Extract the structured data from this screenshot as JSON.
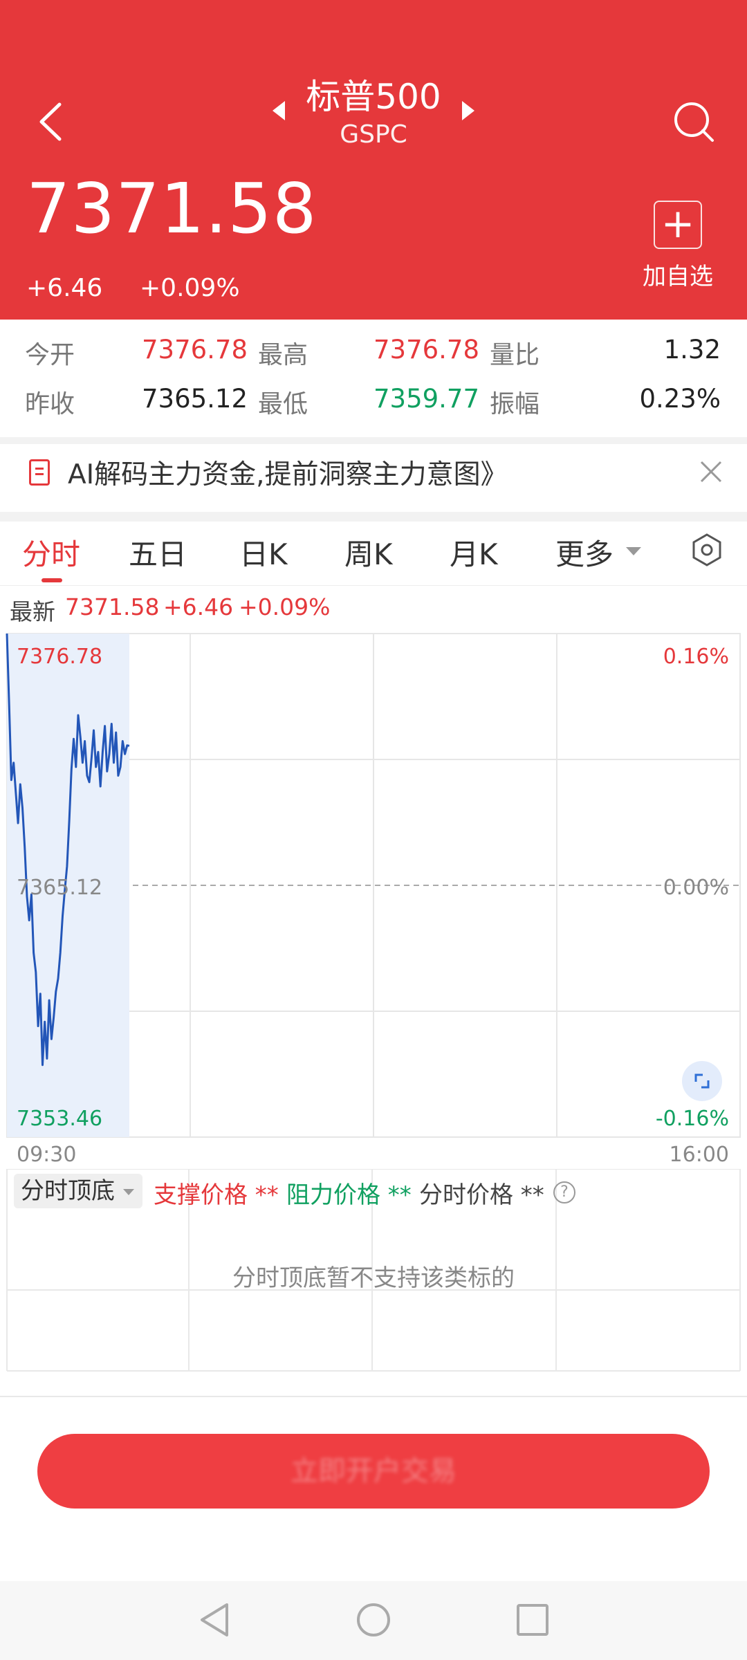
{
  "header": {
    "title": "标普500",
    "subtitle": "GSPC",
    "price": "7371.58",
    "change": "+6.46",
    "change_pct": "+0.09%",
    "add_label": "加自选"
  },
  "stats": {
    "open_label": "今开",
    "open": "7376.78",
    "high_label": "最高",
    "high": "7376.78",
    "vol_ratio_label": "量比",
    "vol_ratio": "1.32",
    "prev_close_label": "昨收",
    "prev_close": "7365.12",
    "low_label": "最低",
    "low": "7359.77",
    "amplitude_label": "振幅",
    "amplitude": "0.23%"
  },
  "banner": {
    "text": "AI解码主力资金,提前洞察主力意图》"
  },
  "tabs": [
    "分时",
    "五日",
    "日K",
    "周K",
    "月K",
    "更多"
  ],
  "latest": {
    "label": "最新",
    "price": "7371.58",
    "change": "+6.46",
    "change_pct": "+0.09%"
  },
  "chart_data": {
    "type": "line",
    "title": "",
    "xlabel": "",
    "ylabel": "",
    "x_range": [
      "09:30",
      "16:00"
    ],
    "ylim": [
      7353.46,
      7376.78
    ],
    "y_ticks": [
      "7376.78",
      "7365.12",
      "7353.46"
    ],
    "y_right_ticks": [
      "0.16%",
      "0.00%",
      "-0.16%"
    ],
    "reference_line": 7365.12,
    "grid": true,
    "series": [
      {
        "color": "#2356b8",
        "values": [
          7376.78,
          7373.5,
          7370.0,
          7370.8,
          7369.4,
          7368.0,
          7369.8,
          7368.7,
          7366.9,
          7364.6,
          7363.5,
          7364.7,
          7362.0,
          7361.1,
          7358.6,
          7360.1,
          7356.8,
          7358.8,
          7357.1,
          7359.8,
          7358.0,
          7359.0,
          7360.2,
          7360.8,
          7362.0,
          7363.7,
          7364.9,
          7366.0,
          7368.1,
          7370.5,
          7371.9,
          7370.6,
          7373.0,
          7372.0,
          7370.8,
          7371.8,
          7370.2,
          7369.9,
          7371.0,
          7372.3,
          7370.6,
          7371.3,
          7369.7,
          7371.3,
          7372.5,
          7370.4,
          7371.2,
          7372.6,
          7370.8,
          7372.2,
          7370.2,
          7370.6,
          7371.8,
          7371.2,
          7371.6,
          7371.58
        ]
      }
    ]
  },
  "indicator": {
    "dropdown": "分时顶底",
    "support": "支撑价格 **",
    "resistance": "阻力价格 **",
    "intraday": "分时价格 **",
    "help": "?",
    "message": "分时顶底暂不支持该类标的"
  },
  "action": {
    "label": "立即开户交易"
  },
  "colors": {
    "brand": "#e5383b",
    "up": "#e5383b",
    "down": "#10a060",
    "line": "#2356b8"
  }
}
